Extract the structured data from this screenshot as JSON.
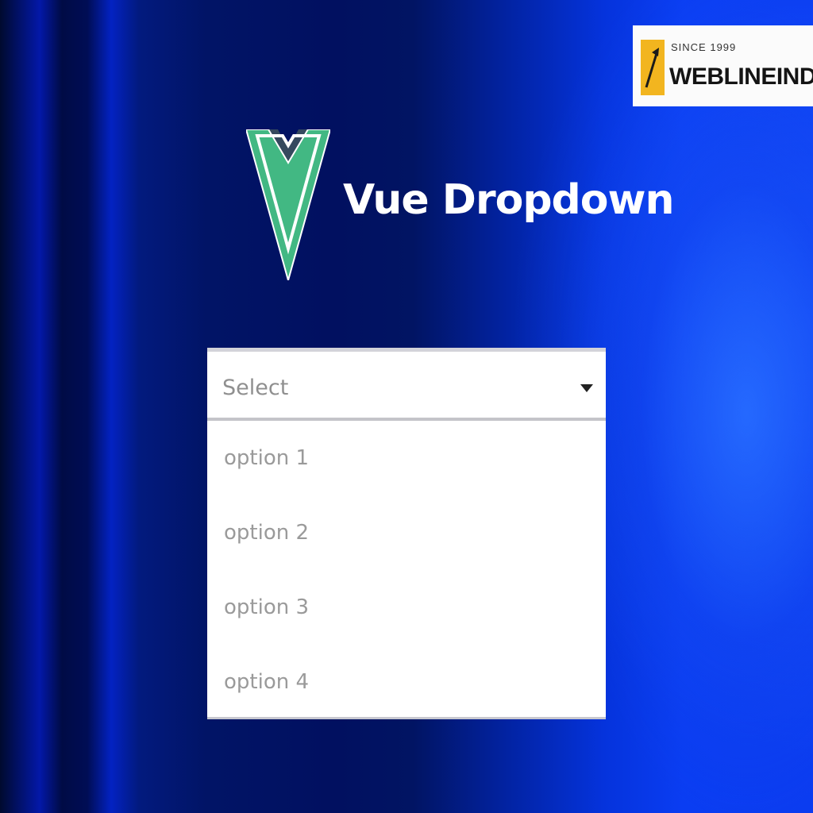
{
  "brand": {
    "since": "SINCE 1999",
    "name": "WEBLINEINDIA",
    "accent_color": "#f2b51f"
  },
  "header": {
    "logo_icon": "vue-logo-icon",
    "title": "Vue Dropdown",
    "logo_colors": {
      "outer": "#42b883",
      "inner": "#35495e"
    }
  },
  "dropdown": {
    "placeholder": "Select",
    "caret_icon": "caret-down-icon",
    "options": [
      {
        "label": "option 1"
      },
      {
        "label": "option 2"
      },
      {
        "label": "option 3"
      },
      {
        "label": "option 4"
      }
    ]
  }
}
